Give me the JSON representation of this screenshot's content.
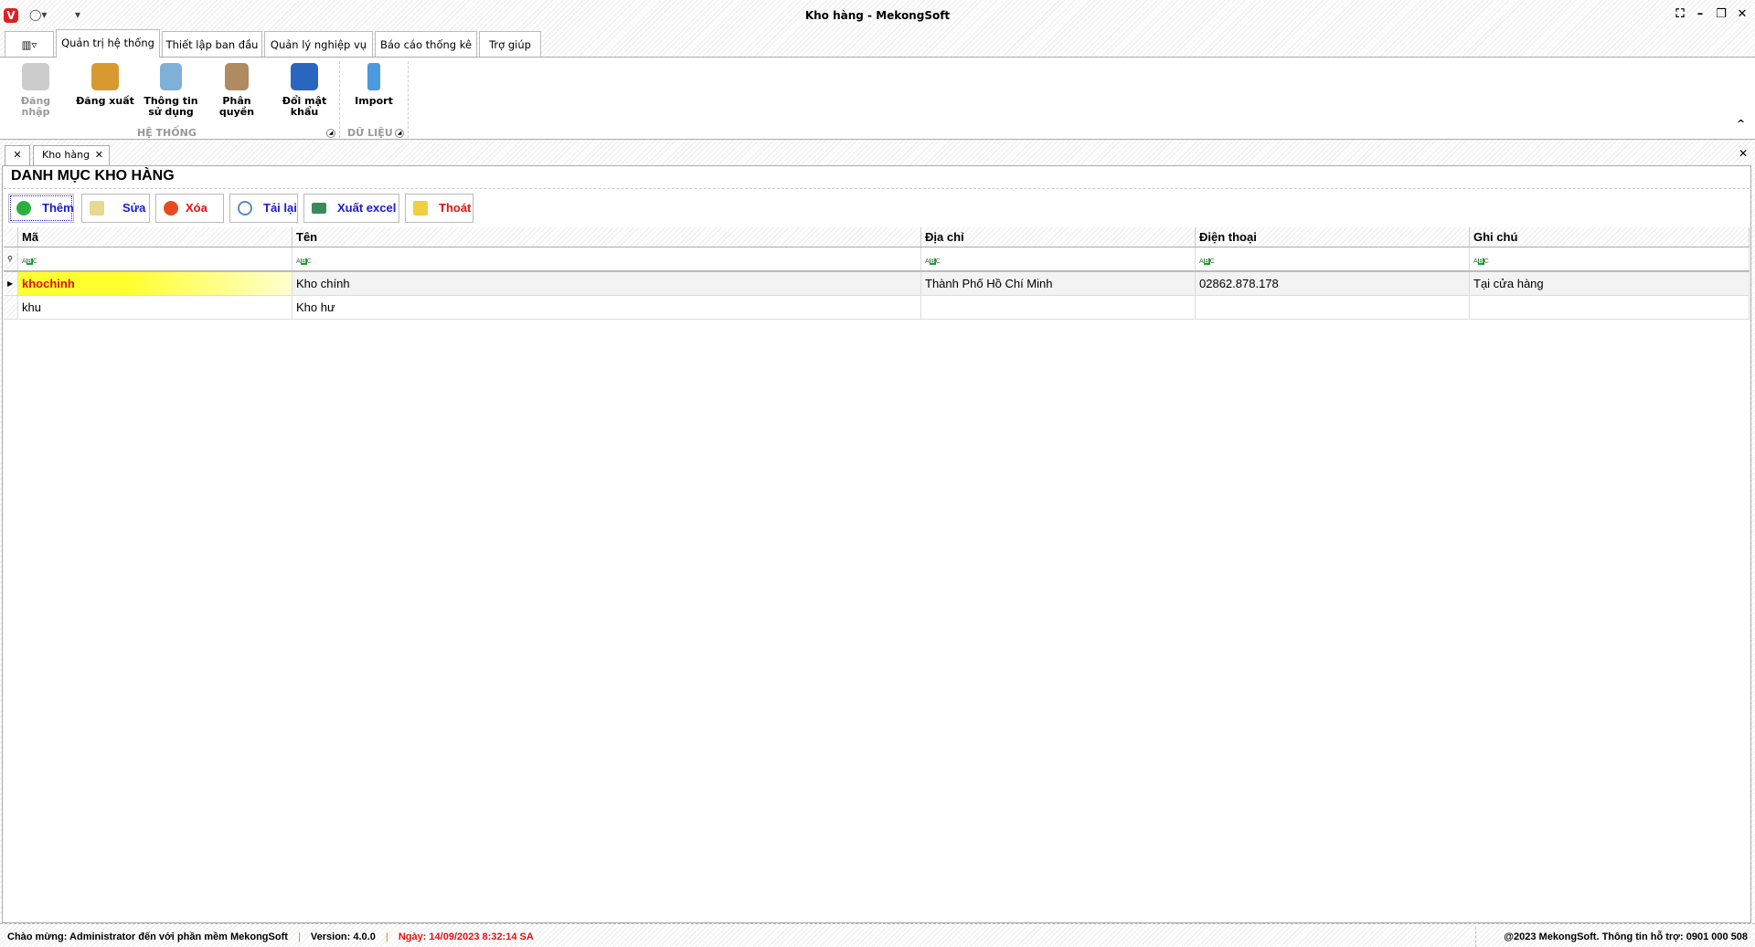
{
  "window": {
    "title": "Kho hàng - MekongSoft"
  },
  "ribbon_tabs": [
    "Quản trị hệ thống",
    "Thiết lập ban đầu",
    "Quản lý nghiệp vụ",
    "Báo cáo thống kê",
    "Trợ giúp"
  ],
  "ribbon": {
    "groups": [
      {
        "label": "HỆ THỐNG"
      },
      {
        "label": "DỮ LIỆU"
      }
    ],
    "buttons": [
      {
        "label": "Đăng nhập",
        "icon": "lock-icon",
        "disabled": true
      },
      {
        "label": "Đăng xuất",
        "icon": "logout-lock-icon"
      },
      {
        "label": "Thông tin sử dụng",
        "icon": "user-info-icon"
      },
      {
        "label": "Phân quyền",
        "icon": "permission-key-icon"
      },
      {
        "label": "Đổi mật khẩu",
        "icon": "change-password-icon"
      },
      {
        "label": "Import",
        "icon": "database-icon"
      }
    ]
  },
  "doc_tab": {
    "label": "Kho hàng"
  },
  "page": {
    "title": "DANH MỤC KHO HÀNG"
  },
  "toolbar": {
    "add": "Thêm",
    "edit": "Sửa",
    "delete": "Xóa",
    "reload": "Tải lại",
    "export": "Xuất excel",
    "exit": "Thoát"
  },
  "grid": {
    "columns": [
      "Mã",
      "Tên",
      "Địa chỉ",
      "Điện thoại",
      "Ghi chú"
    ],
    "rows": [
      [
        "khochinh",
        "Kho chính",
        "Thành Phố Hồ Chí Minh",
        "02862.878.178",
        "Tại cửa hàng"
      ],
      [
        "khu",
        "Kho hư",
        "",
        "",
        ""
      ]
    ]
  },
  "status": {
    "welcome": "Chào mừng: Administrator đến với phần mềm MekongSoft",
    "version": "Version: 4.0.0",
    "date": "Ngày: 14/09/2023 8:32:14 SA",
    "copyright": "@2023 MekongSoft. Thông tin hỗ trợ: 0901 000 508",
    "sep": "|"
  },
  "colors": {
    "accent_red": "#e41010",
    "accent_blue": "#1a1ad6",
    "selected_cell": "#ffff40"
  }
}
